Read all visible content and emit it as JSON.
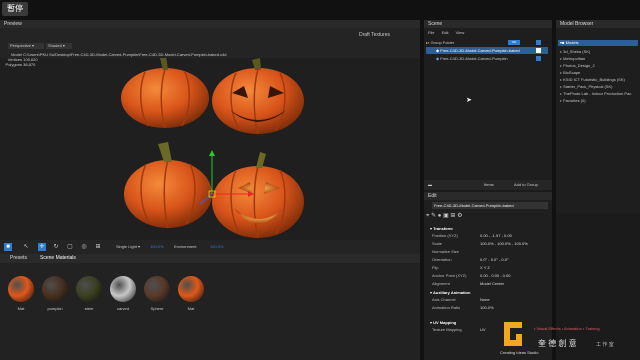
{
  "topbar": {
    "pause_label": "暫停"
  },
  "preview": {
    "title": "Preview",
    "draft_label": "Draft Textures",
    "camera_select": "Perspective",
    "shading_select": "Shaded",
    "info": {
      "model_label": "Model",
      "model_value": "C:\\Users\\PKU Su\\Desktop\\Free-C4D-3D-Model-Carved-Pumpkin\\Free-C4D-3D-Model-Carved-Pumpkin-baked.c4d",
      "vertices_label": "Vertices",
      "vertices_value": "105,620",
      "polygons_label": "Polygons",
      "polygons_value": "38,870"
    },
    "light_select": "Single Light",
    "light_value": "100.0%",
    "environment_label": "Environment",
    "environment_value": "100.0%"
  },
  "materials": {
    "tabs": [
      "Presets",
      "Scene Materials"
    ],
    "items": [
      {
        "name": "Mat",
        "color": "#e0581a"
      },
      {
        "name": "pumpkin",
        "color": "#4a3020"
      },
      {
        "name": "stem",
        "color": "#3a4020"
      },
      {
        "name": "carved",
        "color": "#c8c8c8"
      },
      {
        "name": "Sphere",
        "color": "#5a3a2a"
      },
      {
        "name": "Mat",
        "color": "#e0581a"
      }
    ]
  },
  "scene": {
    "title": "Scene",
    "menu": [
      "File",
      "Edit",
      "View"
    ],
    "items": [
      {
        "label": "Group Folder",
        "tag": "ON"
      },
      {
        "label": "Free-C4D-3D-Model-Carved-Pumpkin-baked"
      },
      {
        "label": "Free-C4D-3D-Model-Carved-Pumpkin"
      }
    ],
    "footer": {
      "items_label": "Items",
      "add_group_label": "Add to Group"
    }
  },
  "edit": {
    "title": "Edit",
    "object_name": "Free-C4D-3D-Model-Carved-Pumpkin-baked",
    "transform": {
      "header": "Transform",
      "rows": [
        {
          "label": "Position (XYZ)",
          "value": "0.00 - -1.97 - 0.00"
        },
        {
          "label": "Scale",
          "value": "100.0% - 100.0% - 100.0%"
        },
        {
          "label": "Normalize Size",
          "value": ""
        },
        {
          "label": "Orientation",
          "value": "0.0° - 0.0° - 0.0°"
        },
        {
          "label": "Flip",
          "value": "X  Y  Z"
        },
        {
          "label": "Anchor Point (XYZ)",
          "value": "0.00 - 0.00 - 0.00"
        },
        {
          "label": "Alignment",
          "value": "Model Center"
        }
      ]
    },
    "aux": {
      "header": "Auxiliary Animation",
      "rows": [
        {
          "label": "Axis Channel",
          "value": "None"
        },
        {
          "label": "Animation Ratio",
          "value": "100.0%"
        }
      ]
    },
    "uv": {
      "header": "UV Mapping",
      "rows": [
        {
          "label": "Texture Mapping",
          "value": "UV"
        }
      ]
    }
  },
  "browser": {
    "title": "Model Browser",
    "root": "Models",
    "items": [
      "3d_Sheka (SK)",
      "Metropolitan",
      "Photos_Design_2",
      "BioScape",
      "KSID ICT Futuristic_Buildings (SK)",
      "Starter_Pack_Physical (SK)",
      "ThePhoto Lab - Indoor Production Pac",
      "Favorites (0)"
    ]
  },
  "watermark": {
    "tagline": "• Visual Effects • Animation • Training",
    "brand_cn": "奎 德 創 意",
    "studio_cn": "工 作 室",
    "brand_en": "Creating Ideas Studio"
  },
  "colors": {
    "accent": "#2d7dd2",
    "pumpkin": "#e0581a",
    "gizmo_red": "#e22",
    "gizmo_green": "#2c2"
  }
}
